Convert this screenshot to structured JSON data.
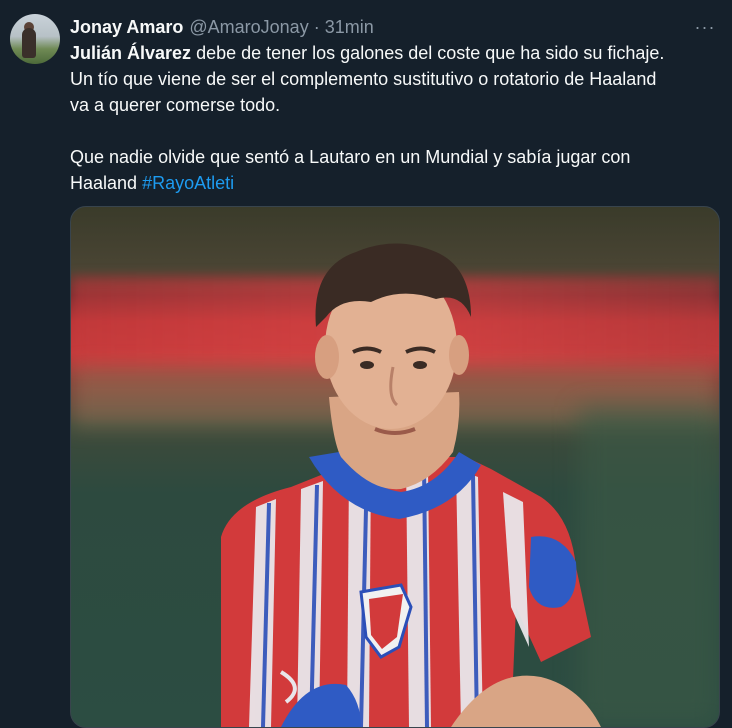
{
  "tweet": {
    "author_name": "Jonay Amaro",
    "handle": "@AmaroJonay",
    "separator": "·",
    "time": "31min",
    "more_label": "···",
    "text": {
      "line1_bold": "Julián Álvarez",
      "line1_rest": " debe de tener los galones del coste que ha sido su fichaje.",
      "line2": "Un tío que viene de ser el complemento sustitutivo o rotatorio de Haaland",
      "line3": "va a querer comerse todo.",
      "line4": "Que nadie olvide que sentó a Lautaro en un Mundial y sabía jugar con",
      "line5_text": "Haaland ",
      "hashtag": "#RayoAtleti"
    },
    "colors": {
      "background": "#15202b",
      "text": "#f7f9f9",
      "muted": "#8b98a5",
      "link": "#1d9bf0"
    },
    "icons": [
      "more-options-icon"
    ]
  }
}
